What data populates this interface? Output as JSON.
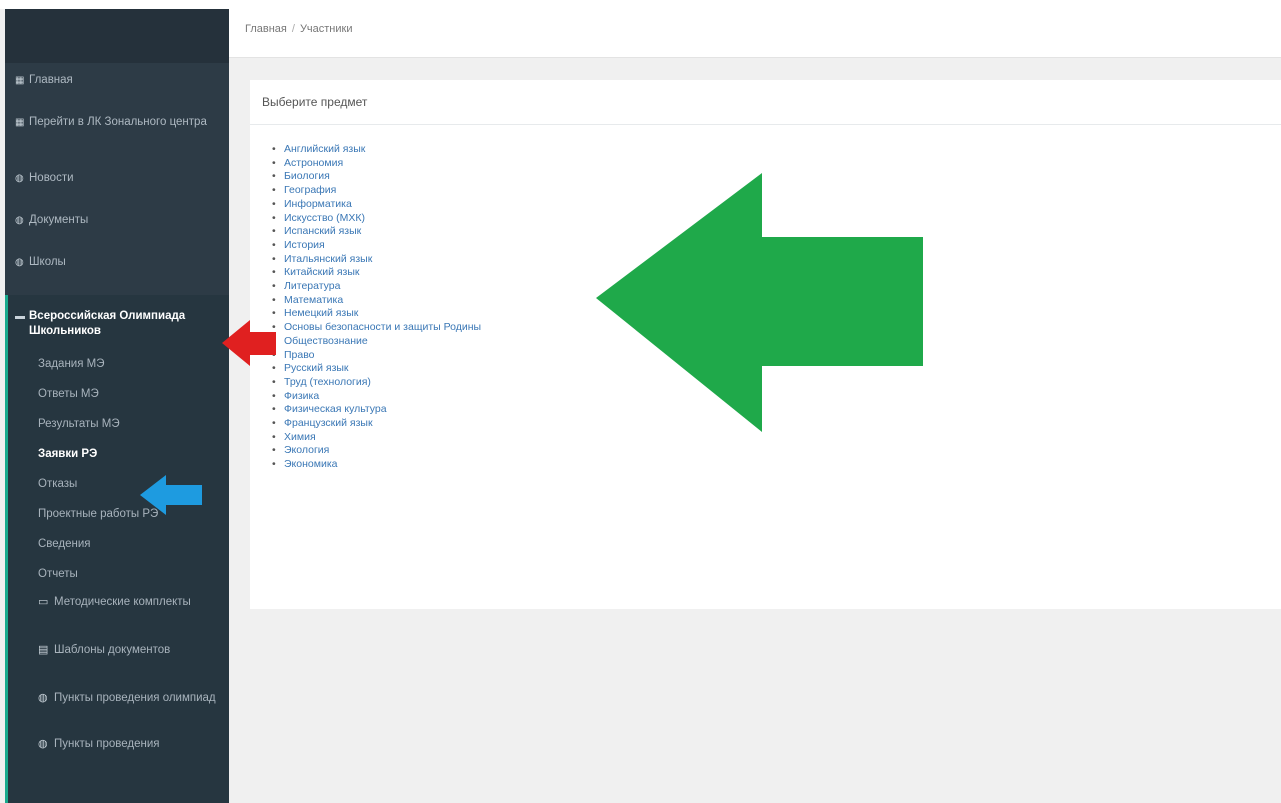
{
  "topbar": {
    "corner_text": ""
  },
  "breadcrumb": {
    "home": "Главная",
    "separator": "/",
    "current": "Участники"
  },
  "sidebar": {
    "items": [
      {
        "icon": "grid-icon",
        "glyph": "▦",
        "label": "Главная"
      },
      {
        "icon": "grid-icon",
        "glyph": "▦",
        "label": "Перейти в ЛК Зонального центра"
      },
      {
        "icon": "globe-icon",
        "glyph": "◍",
        "label": "Новости"
      },
      {
        "icon": "globe-icon",
        "glyph": "◍",
        "label": "Документы"
      },
      {
        "icon": "globe-icon",
        "glyph": "◍",
        "label": "Школы"
      }
    ],
    "section": {
      "icon": "envelope-icon",
      "glyph": "▬",
      "label": "Всероссийская Олимпиада Школьников"
    },
    "subitems": [
      {
        "label": "Задания МЭ"
      },
      {
        "label": "Ответы МЭ"
      },
      {
        "label": "Результаты МЭ"
      },
      {
        "label": "Заявки РЭ"
      },
      {
        "label": "Отказы"
      },
      {
        "label": "Проектные работы РЭ"
      },
      {
        "label": "Сведения"
      },
      {
        "label": "Отчеты"
      },
      {
        "label": "Методические комплекты",
        "icon": "monitor-icon",
        "glyph": "▭"
      },
      {
        "label": "Шаблоны документов",
        "icon": "document-icon",
        "glyph": "▤"
      },
      {
        "label": "Пункты проведения олимпиад",
        "icon": "globe-icon",
        "glyph": "◍"
      },
      {
        "label": "Пункты проведения",
        "icon": "globe-icon",
        "glyph": "◍"
      }
    ]
  },
  "panel": {
    "title": "Выберите предмет",
    "subjects": [
      "Английский язык",
      "Астрономия",
      "Биология",
      "География",
      "Информатика",
      "Искусство (МХК)",
      "Испанский язык",
      "История",
      "Итальянский язык",
      "Китайский язык",
      "Литература",
      "Математика",
      "Немецкий язык",
      "Основы безопасности и защиты Родины",
      "Обществознание",
      "Право",
      "Русский язык",
      "Труд (технология)",
      "Физика",
      "Физическая культура",
      "Французский язык",
      "Химия",
      "Экология",
      "Экономика"
    ]
  },
  "annotations": {
    "green_arrow": "#1fa94a",
    "red_arrow": "#e02020",
    "blue_arrow": "#1e9be0"
  }
}
